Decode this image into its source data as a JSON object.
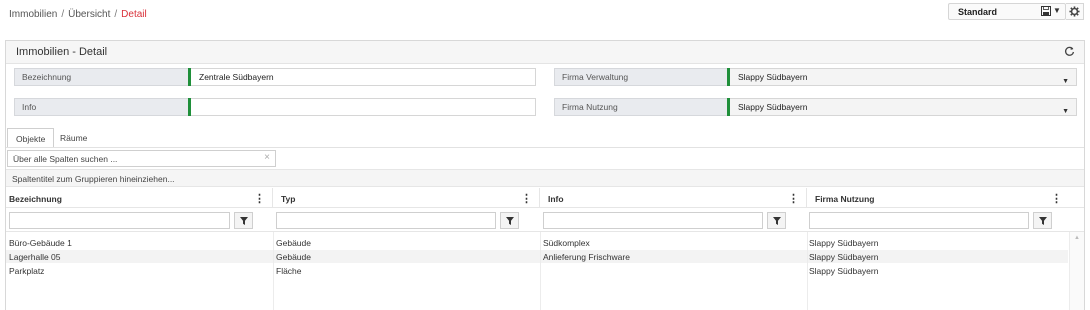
{
  "breadcrumb": {
    "items": [
      "Immobilien",
      "Übersicht"
    ],
    "current": "Detail",
    "separator": "/"
  },
  "view": {
    "selected": "Standard"
  },
  "panel": {
    "title": "Immobilien - Detail"
  },
  "form": {
    "bezeichnung": {
      "label": "Bezeichnung",
      "value": "Zentrale Südbayern"
    },
    "info": {
      "label": "Info",
      "value": ""
    },
    "firma_verwaltung": {
      "label": "Firma Verwaltung",
      "value": "Slappy Südbayern"
    },
    "firma_nutzung": {
      "label": "Firma Nutzung",
      "value": "Slappy Südbayern"
    }
  },
  "tabs": [
    {
      "label": "Objekte",
      "active": true
    },
    {
      "label": "Räume",
      "active": false
    }
  ],
  "search": {
    "placeholder": "Über alle Spalten suchen ..."
  },
  "grouping": {
    "hint": "Spaltentitel zum Gruppieren hineinziehen..."
  },
  "grid": {
    "columns": [
      "Bezeichnung",
      "Typ",
      "Info",
      "Firma Nutzung"
    ],
    "rows": [
      [
        "Büro-Gebäude 1",
        "Gebäude",
        "Südkomplex",
        "Slappy Südbayern"
      ],
      [
        "Lagerhalle 05",
        "Gebäude",
        "Anlieferung Frischware",
        "Slappy Südbayern"
      ],
      [
        "Parkplatz",
        "Fläche",
        "",
        "Slappy Südbayern"
      ]
    ]
  },
  "colors": {
    "accent_red": "#d9313a",
    "field_marker_green": "#1f8f3a"
  },
  "icons": {
    "save": "floppy-icon",
    "settings": "gear-icon",
    "refresh": "refresh-icon",
    "filter": "filter-icon",
    "clear": "close-icon"
  }
}
